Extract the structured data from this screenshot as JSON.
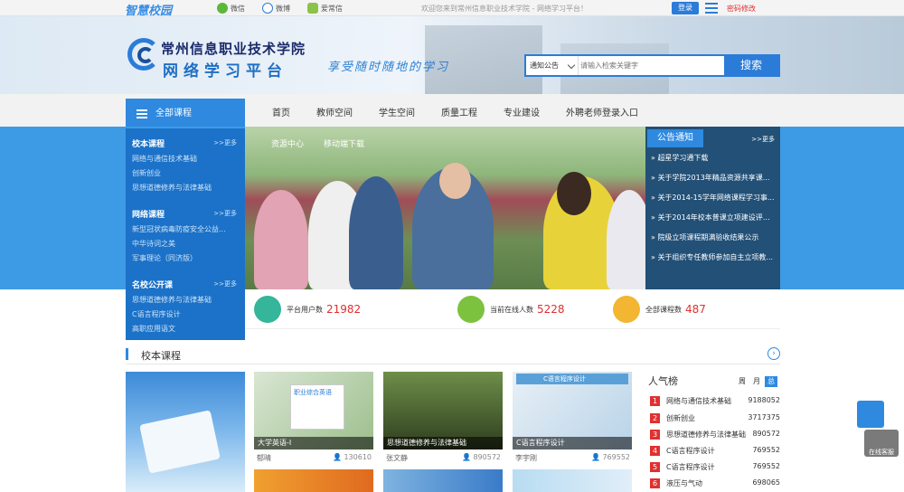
{
  "topbar": {
    "logo": "智慧校园",
    "wechat": "微信",
    "weibo": "微博",
    "mobile": "爱常信",
    "welcome": "欢迎您来到常州信息职业技术学院 - 网络学习平台！",
    "login": "登录",
    "password": "密码修改"
  },
  "header": {
    "school_name": "常州信息职业技术学院",
    "platform_name": "网络学习平台",
    "slogan": "享受随时随地的学习",
    "search": {
      "category": "通知公告",
      "placeholder": "请输入检索关键字",
      "button": "搜索"
    }
  },
  "nav": {
    "all_courses": "全部课程",
    "items": [
      "首页",
      "教师空间",
      "学生空间",
      "质量工程",
      "专业建设",
      "外聘老师登录入口"
    ]
  },
  "sidebar": {
    "more": ">>更多",
    "sections": [
      {
        "title": "校本课程",
        "items": [
          "网络与通信技术基础",
          "创新创业",
          "思想道德修养与法律基础"
        ]
      },
      {
        "title": "网络课程",
        "items": [
          "新型冠状病毒防疫安全公益...",
          "中华诗词之美",
          "军事理论（同济版）"
        ]
      },
      {
        "title": "名校公开课",
        "items": [
          "思想道德修养与法律基础",
          "C语言程序设计",
          "高职应用语文"
        ]
      }
    ]
  },
  "slider": {
    "tabs": [
      "资源中心",
      "移动端下载"
    ]
  },
  "notices": {
    "title": "公告通知",
    "more": ">>更多",
    "items": [
      "超星学习通下载",
      "关于学院2013年精品资源共享课...",
      "关于2014-15学年网络课程学习事...",
      "关于2014年校本普课立项建设评审...",
      "院级立项课程期满验收结果公示",
      "关于组织专任教师参加自主立项教..."
    ]
  },
  "stats": [
    {
      "label": "平台用户数",
      "value": "21982",
      "icon": "users-icon",
      "color": "#35b59a"
    },
    {
      "label": "当前在线人数",
      "value": "5228",
      "icon": "online-icon",
      "color": "#7cc23e"
    },
    {
      "label": "全部课程数",
      "value": "487",
      "icon": "courses-icon",
      "color": "#f2b632"
    }
  ],
  "courses_section": {
    "title": "校本课程",
    "cards": [
      {
        "name": "大学英语-I",
        "teacher": "郁晴",
        "count": "130610"
      },
      {
        "name": "思想道德修养与法律基础",
        "teacher": "张文静",
        "count": "890572"
      },
      {
        "name": "C语言程序设计",
        "teacher": "李宇刚",
        "count": "769552"
      }
    ],
    "card_extra_text": [
      "职业综合英语",
      "C语言程序设计"
    ]
  },
  "ranking": {
    "title": "人气榜",
    "tabs": [
      "周",
      "月",
      "总"
    ],
    "rows": [
      {
        "no": "1",
        "name": "网络与通信技术基础",
        "value": "9188052"
      },
      {
        "no": "2",
        "name": "创新创业",
        "value": "3717375"
      },
      {
        "no": "3",
        "name": "思想道德修养与法律基础",
        "value": "890572"
      },
      {
        "no": "4",
        "name": "C语言程序设计",
        "value": "769552"
      },
      {
        "no": "5",
        "name": "C语言程序设计",
        "value": "769552"
      },
      {
        "no": "6",
        "name": "液压与气动",
        "value": "698065"
      }
    ]
  },
  "support": {
    "label": "在线客服"
  }
}
